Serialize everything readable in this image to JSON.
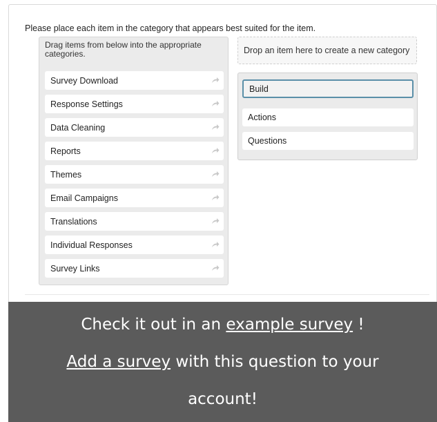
{
  "prompt": "Please place each item in the category that appears best suited for the item.",
  "source": {
    "hint": "Drag items from below into the appropriate categories.",
    "items": [
      "Survey Download",
      "Response Settings",
      "Data Cleaning",
      "Reports",
      "Themes",
      "Email Campaigns",
      "Translations",
      "Individual Responses",
      "Survey Links"
    ]
  },
  "new_category": {
    "label": "Drop an item here to create a new category"
  },
  "category": {
    "title": "Build",
    "items": [
      "Actions",
      "Questions"
    ]
  },
  "banner": {
    "line1_before": "Check it out in an ",
    "line1_link": "example survey",
    "line1_after": " !",
    "line2_link": "Add a survey",
    "line2_after": " with this question to your",
    "line3": "account!"
  },
  "colors": {
    "banner_bg": "#5b5b5b",
    "category_title_border": "#5a8fa8"
  },
  "icons": {
    "item_action": "share-arrow-icon"
  }
}
